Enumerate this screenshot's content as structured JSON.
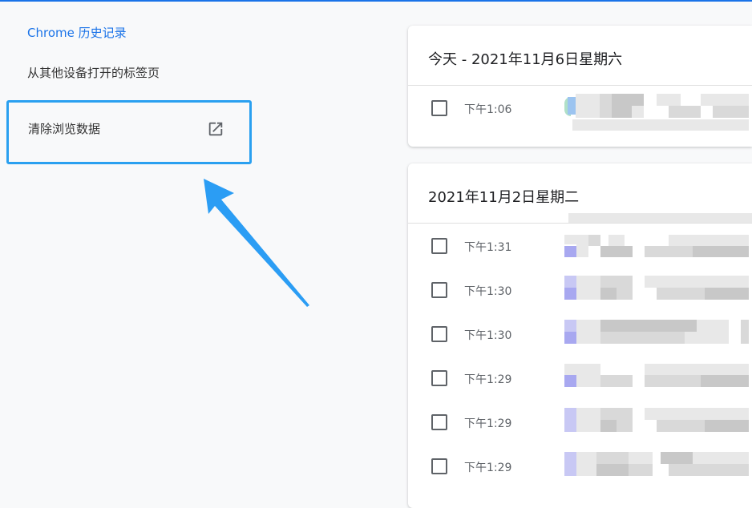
{
  "sidebar": {
    "title": "Chrome 历史记录",
    "other_devices": "从其他设备打开的标签页",
    "clear_data": "清除浏览数据"
  },
  "history": {
    "groups": [
      {
        "date": "今天 - 2021年11月6日星期六",
        "entries": [
          {
            "time": "下午1:06"
          }
        ]
      },
      {
        "date": "2021年11月2日星期二",
        "entries": [
          {
            "time": "下午1:31"
          },
          {
            "time": "下午1:30"
          },
          {
            "time": "下午1:30"
          },
          {
            "time": "下午1:29"
          },
          {
            "time": "下午1:29"
          },
          {
            "time": "下午1:29"
          }
        ]
      }
    ]
  },
  "colors": {
    "accent": "#1a73e8",
    "highlight_border": "#2aa0f0",
    "arrow": "#2b9df4"
  },
  "icons": {
    "open_in_new": "open-in-new-icon",
    "annotation_arrow": "arrow-annotation"
  }
}
